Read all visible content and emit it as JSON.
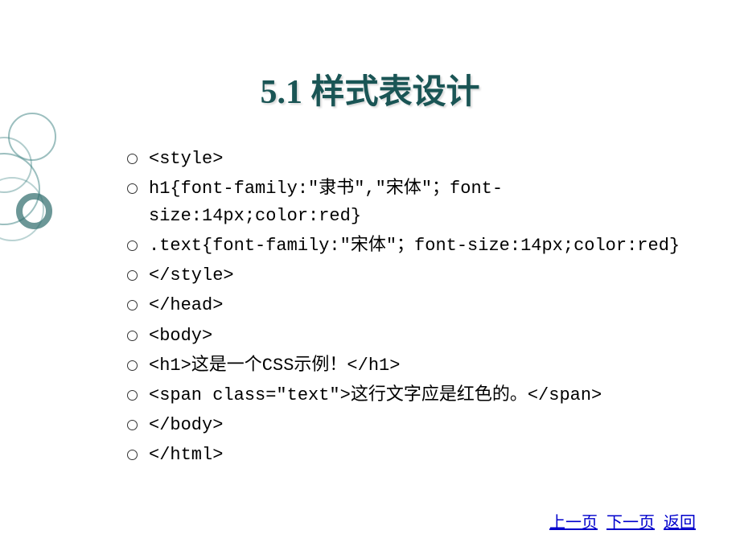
{
  "title": "5.1  样式表设计",
  "bullets": [
    "<style>",
    "h1{font-family:\"隶书\",\"宋体\"；font-size:14px;color:red}",
    ".text{font-family:\"宋体\"；font-size:14px;color:red}",
    "</style>",
    "</head>",
    "<body>",
    "<h1>这是一个CSS示例！</h1>",
    "<span class=\"text\">这行文字应是红色的。</span>",
    "</body>",
    "</html>"
  ],
  "footer": {
    "prev": "上一页",
    "next": "下一页",
    "back": "返回"
  }
}
